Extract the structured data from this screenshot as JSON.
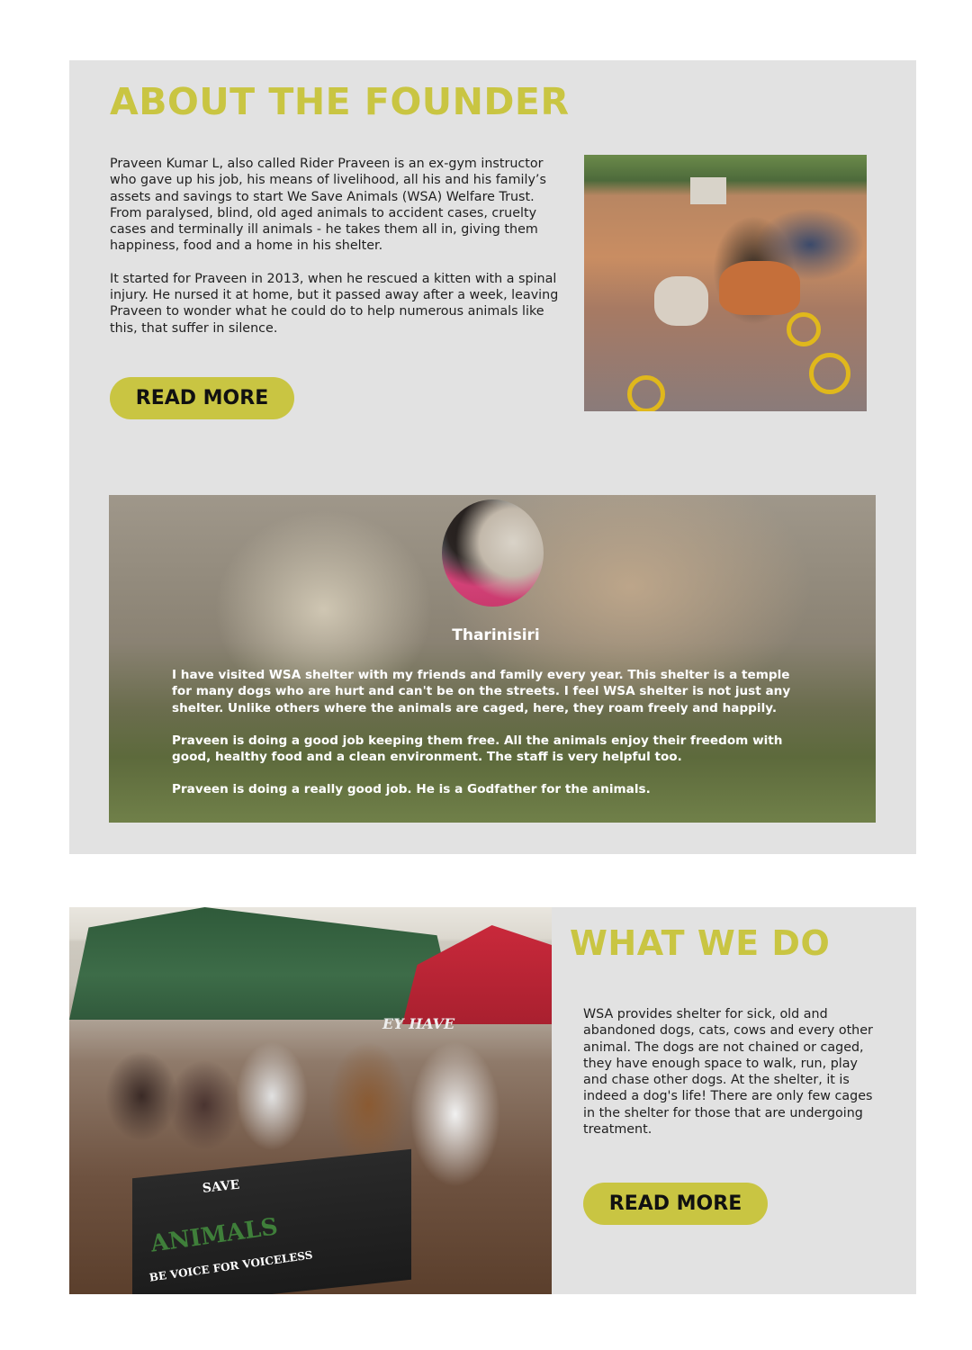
{
  "about": {
    "heading": "ABOUT THE FOUNDER",
    "paragraphs": [
      "Praveen Kumar L, also called Rider Praveen is an ex-gym instructor who gave up his job, his means of livelihood, all his and his family’s assets and savings to start We Save Animals (WSA) Welfare Trust. From paralysed, blind, old aged animals to accident cases, cruelty cases and terminally ill animals - he takes them all in, giving them happiness, food and a home in his shelter.",
      "It started for Praveen in 2013, when he rescued a kitten with a spinal injury. He nursed it at home, but it passed away after a week, leaving Praveen to wonder what he could do to help numerous animals like this, that suffer in silence."
    ],
    "read_more_label": "READ MORE"
  },
  "testimonial": {
    "name": "Tharinisiri",
    "paragraphs": [
      "I have visited WSA shelter with my friends and family every year. This shelter is a temple for many dogs who are hurt and can't be on the streets. I feel WSA shelter is not just any shelter. Unlike others where the animals are caged, here, they roam freely and happily.",
      "Praveen is doing a good job keeping them free. All the animals enjoy their freedom with good, healthy food and a clean environment. The staff is very helpful too.",
      "Praveen is doing a really good job. He is a Godfather for the animals."
    ]
  },
  "what_we_do": {
    "heading": "WHAT WE DO",
    "paragraph": "WSA provides shelter for sick, old and abandoned dogs, cats, cows and every other animal. The dogs are not chained or caged, they have enough space to walk, run, play and chase other dogs. At the shelter, it is indeed a dog's life! There are only few cages in the shelter for those that are undergoing treatment.",
    "read_more_label": "READ MORE"
  },
  "photo_text": {
    "banner_save": "SAVE",
    "banner_animals": "ANIMALS",
    "banner_sub": "BE VOICE FOR VOICELESS",
    "tent_sign": "EY HAVE"
  },
  "colors": {
    "accent": "#c9c542",
    "panel": "#e2e2e2"
  }
}
